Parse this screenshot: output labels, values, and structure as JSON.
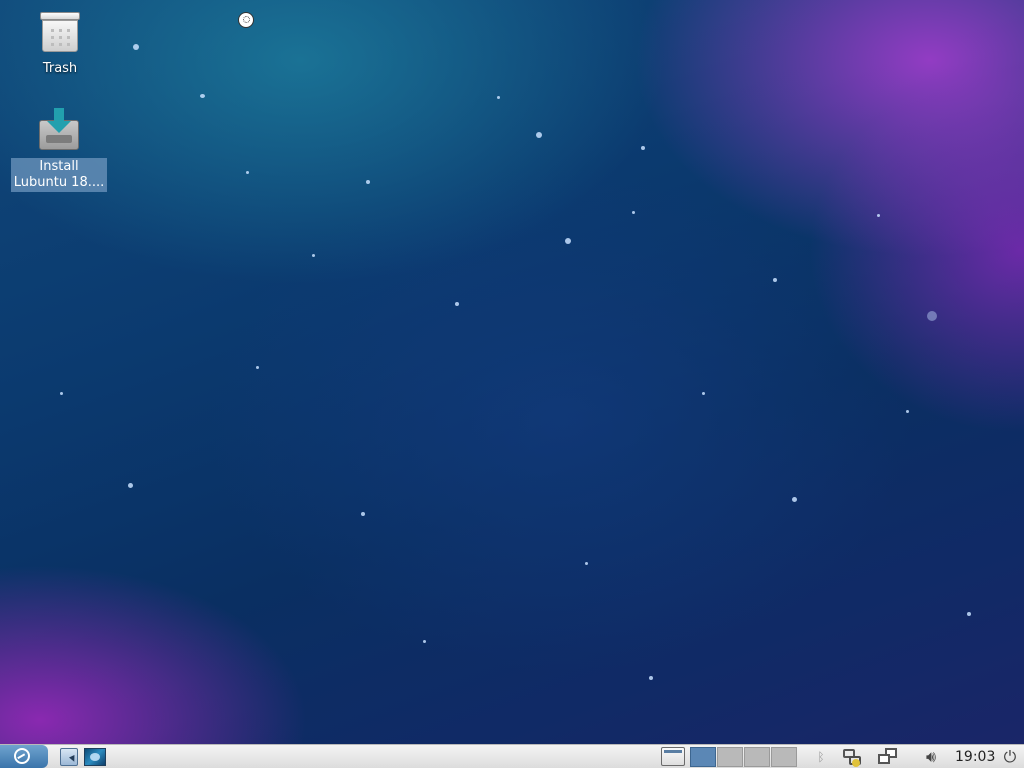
{
  "desktop": {
    "icons": [
      {
        "label": "Trash"
      },
      {
        "label": "Install\nLubuntu 18...."
      }
    ]
  },
  "taskbar": {
    "clock": "19:03",
    "workspaces": 4,
    "active_workspace": 1
  },
  "icons": {
    "menu": "lubuntu-logo-icon",
    "file_manager": "file-manager-icon",
    "browser": "web-browser-icon",
    "show_desktop": "show-desktop-icon",
    "bluetooth": "bluetooth-icon",
    "network": "network-icon",
    "windows": "window-switcher-icon",
    "volume": "volume-icon",
    "power": "power-icon"
  },
  "colors": {
    "taskbar_bg": "#e6e6e6",
    "active_workspace": "#5b87b5",
    "inactive_workspace": "#b9b9b9",
    "selection": "#6e96be"
  }
}
